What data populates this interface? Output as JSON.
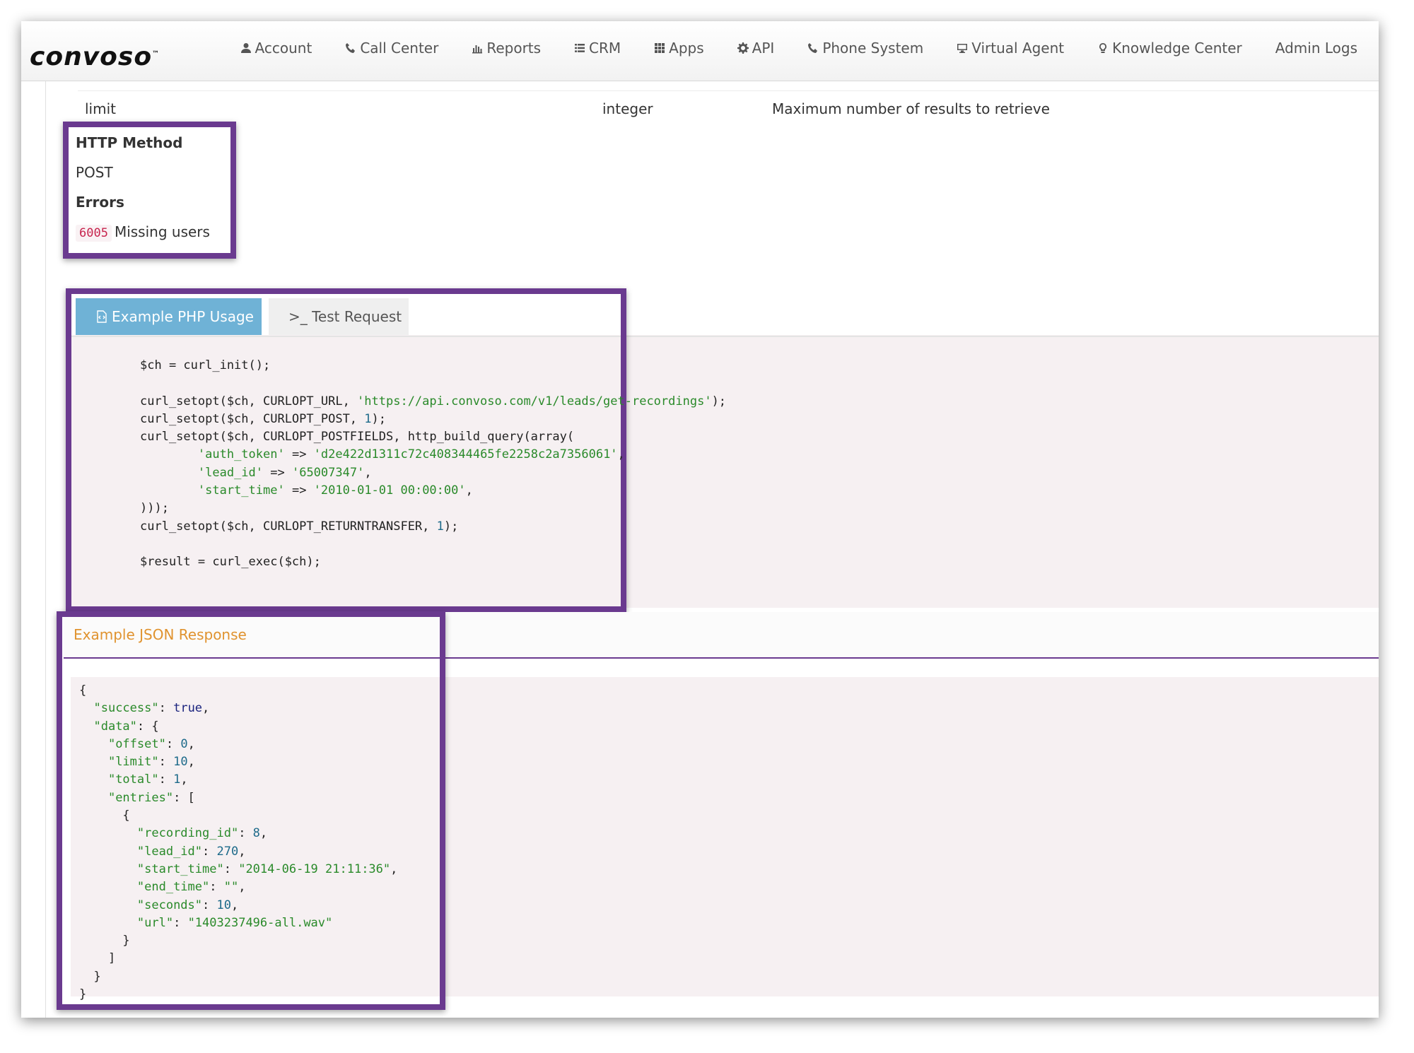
{
  "brand": {
    "logo_text": "convoso",
    "logo_mark": "™"
  },
  "nav": [
    {
      "label": "Account",
      "icon": "user-icon"
    },
    {
      "label": "Call Center",
      "icon": "phone-icon"
    },
    {
      "label": "Reports",
      "icon": "bar-chart-icon"
    },
    {
      "label": "CRM",
      "icon": "list-icon"
    },
    {
      "label": "Apps",
      "icon": "grid-icon"
    },
    {
      "label": "API",
      "icon": "gear-icon"
    },
    {
      "label": "Phone System",
      "icon": "phone-icon"
    },
    {
      "label": "Virtual Agent",
      "icon": "monitor-icon"
    },
    {
      "label": "Knowledge Center",
      "icon": "lightbulb-icon"
    },
    {
      "label": "Admin Logs",
      "icon": ""
    }
  ],
  "param_row": {
    "name": "limit",
    "type": "integer",
    "description": "Maximum number of results to retrieve"
  },
  "method": {
    "heading": "HTTP Method",
    "value": "POST"
  },
  "errors": {
    "heading": "Errors",
    "code": "6005",
    "message": "Missing users"
  },
  "tabs": {
    "php": "Example PHP Usage",
    "test": ">_ Test Request"
  },
  "php_code": {
    "l1": "$ch = curl_init();",
    "l2a": "curl_setopt($ch, CURLOPT_URL, ",
    "l2s": "'https://api.convoso.com/v1/leads/get-recordings'",
    "l2b": ");",
    "l3a": "curl_setopt($ch, CURLOPT_POST, ",
    "l3n": "1",
    "l3b": ");",
    "l4": "curl_setopt($ch, CURLOPT_POSTFIELDS, http_build_query(array(",
    "l5k": "'auth_token'",
    "l5v": "'d2e422d1311c72c408344465fe2258c2a7356061'",
    "l6k": "'lead_id'",
    "l6v": "'65007347'",
    "l7k": "'start_time'",
    "l7v": "'2010-01-01 00:00:00'",
    "arrow": " => ",
    "comma": ",",
    "l8": ")));",
    "l9a": "curl_setopt($ch, CURLOPT_RETURNTRANSFER, ",
    "l9n": "1",
    "l9b": ");",
    "l10": "$result = curl_exec($ch);"
  },
  "json_response": {
    "title": "Example JSON Response",
    "lines": {
      "open": "{",
      "success_k": "\"success\"",
      "success_v": "true",
      "data_k": "\"data\"",
      "data_open": ": {",
      "offset_k": "\"offset\"",
      "offset_v": "0",
      "limit_k": "\"limit\"",
      "limit_v": "10",
      "total_k": "\"total\"",
      "total_v": "1",
      "entries_k": "\"entries\"",
      "entries_open": ": [",
      "obj_open": "{",
      "rec_k": "\"recording_id\"",
      "rec_v": "8",
      "lead_k": "\"lead_id\"",
      "lead_v": "270",
      "start_k": "\"start_time\"",
      "start_v": "\"2014-06-19 21:11:36\"",
      "end_k": "\"end_time\"",
      "end_v": "\"\"",
      "sec_k": "\"seconds\"",
      "sec_v": "10",
      "url_k": "\"url\"",
      "url_v": "\"1403237496-all.wav\"",
      "obj_close": "}",
      "arr_close": "]",
      "data_close": "}",
      "close": "}"
    }
  },
  "colors": {
    "highlight": "#6a3a8f",
    "tab_active": "#6fb2d6",
    "json_title": "#e0932f",
    "code_string": "#2a8a2a",
    "code_number": "#1d6a8a"
  }
}
